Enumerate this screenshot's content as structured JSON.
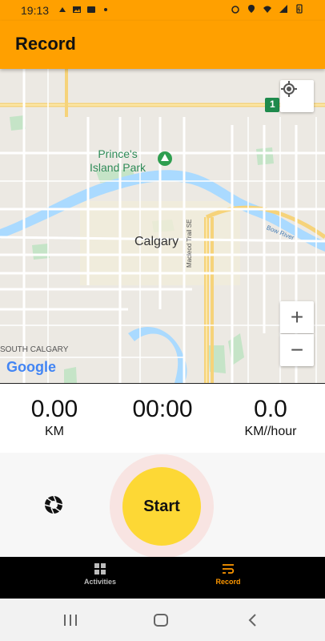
{
  "status_bar": {
    "time": "19:13"
  },
  "app_bar": {
    "title": "Record"
  },
  "map": {
    "labels": {
      "park": "Prince's\nIsland Park",
      "city": "Calgary",
      "district": "SOUTH CALGARY",
      "trail": "Macleod Trail SE",
      "river": "Bow River",
      "highway_shield": "1",
      "logo": "Google"
    },
    "zoom_in": "+",
    "zoom_out": "−"
  },
  "stats": {
    "distance": {
      "value": "0.00",
      "unit": "KM"
    },
    "duration": {
      "value": "00:00",
      "unit": ""
    },
    "speed": {
      "value": "0.0",
      "unit": "KM//hour"
    }
  },
  "controls": {
    "start_label": "Start"
  },
  "bottom_nav": {
    "items": [
      {
        "label": "Activities",
        "color": "#bdbdbd"
      },
      {
        "label": "Record",
        "color": "#ff9800"
      }
    ]
  },
  "colors": {
    "accent": "#ffa000",
    "start": "#fdd835",
    "halo": "#f8e4e2",
    "active_nav": "#ff9800"
  }
}
